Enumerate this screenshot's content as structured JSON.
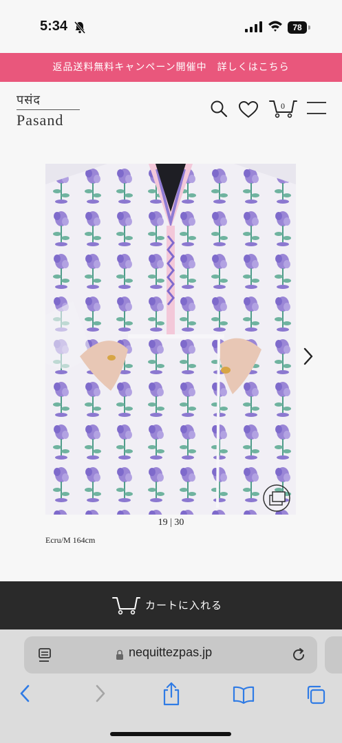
{
  "status": {
    "time": "5:34",
    "battery": "78"
  },
  "banner": {
    "text": "返品送料無料キャンペーン開催中　詳しくはこちら"
  },
  "logo": {
    "devanagari": "पसंद",
    "latin": "Pasand"
  },
  "header": {
    "cart_count": "0"
  },
  "product": {
    "image_counter": "19 | 30",
    "caption": "Ecru/M 164cm"
  },
  "cart_button": {
    "label": "カートに入れる"
  },
  "browser": {
    "url": "nequittezpas.jp"
  },
  "colors": {
    "banner": "#e9577c",
    "cart_bar": "#2a2a2a",
    "accent_blue": "#2f7be5"
  }
}
